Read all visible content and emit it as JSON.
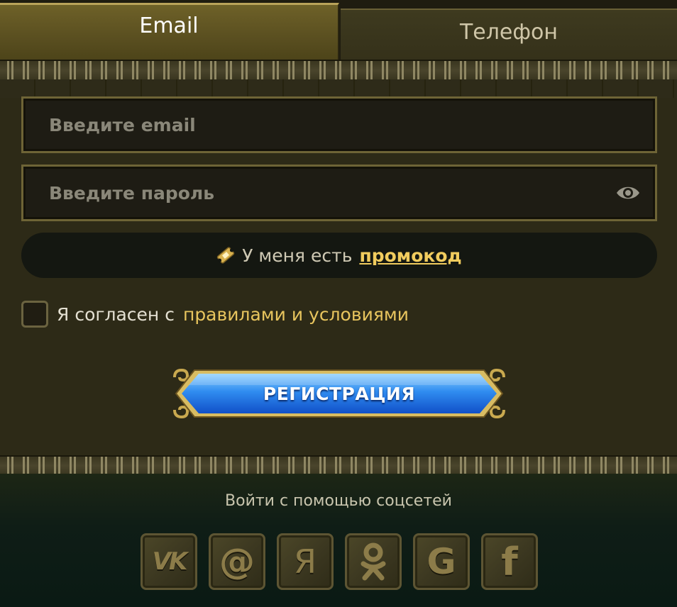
{
  "tabs": {
    "email": "Email",
    "phone": "Телефон"
  },
  "form": {
    "email_placeholder": "Введите email",
    "password_placeholder": "Введите пароль",
    "promo_prefix": "У меня есть",
    "promo_link": "промокод",
    "agree_prefix": "Я согласен с",
    "agree_link": "правилами и условиями",
    "register_label": "РЕГИСТРАЦИЯ"
  },
  "social": {
    "title": "Войти с помощью соцсетей",
    "buttons": [
      {
        "name": "vk",
        "glyph": "VK"
      },
      {
        "name": "mail",
        "glyph": "@"
      },
      {
        "name": "yandex",
        "glyph": "Я"
      },
      {
        "name": "odnoklassniki",
        "glyph": "ok-icon"
      },
      {
        "name": "google",
        "glyph": "G"
      },
      {
        "name": "facebook",
        "glyph": "f"
      }
    ]
  },
  "colors": {
    "accent": "#f1cc5e",
    "button_blue": "#2f8cf0",
    "frame_gold": "#c9a94f"
  }
}
